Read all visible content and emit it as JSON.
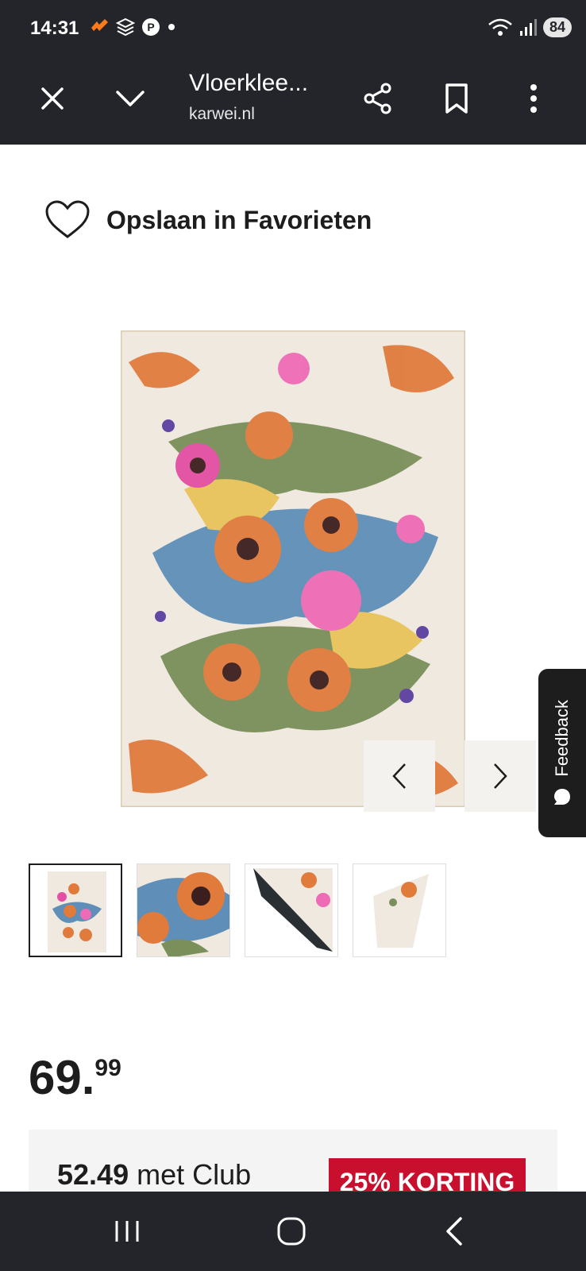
{
  "status": {
    "time": "14:31",
    "battery": "84"
  },
  "toolbar": {
    "title": "Vloerklee...",
    "url": "karwei.nl"
  },
  "favorites": {
    "label": "Opslaan in Favorieten"
  },
  "feedback": {
    "label": "Feedback"
  },
  "price": {
    "main": "69.",
    "decimals": "99"
  },
  "club": {
    "price": "52.49",
    "suffix": " met Club",
    "badge": "25% KORTING"
  },
  "colors": {
    "bar": "#23252b",
    "accent": "#c8102e",
    "text": "#1d1d1d"
  },
  "thumbnails": [
    "rug-full",
    "rug-detail",
    "rug-backside",
    "rug-rolled"
  ]
}
